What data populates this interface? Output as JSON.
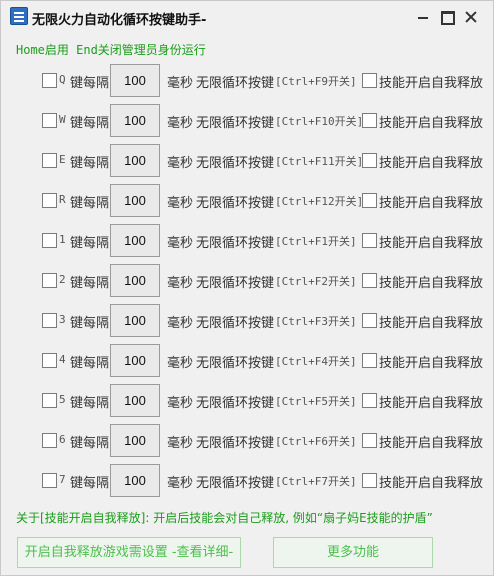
{
  "window": {
    "title": "无限火力自动化循环按键助手-"
  },
  "hotkey_hint": "Home启用 End关闭管理员身份运行",
  "rows": [
    {
      "key": "Q",
      "every": "键每隔",
      "interval": "100",
      "ms": "毫秒",
      "loop": "无限循环按键",
      "shortcut": "[Ctrl+F9开关]",
      "self_cast": "技能开启自我释放"
    },
    {
      "key": "W",
      "every": "键每隔",
      "interval": "100",
      "ms": "毫秒",
      "loop": "无限循环按键",
      "shortcut": "[Ctrl+F10开关]",
      "self_cast": "技能开启自我释放"
    },
    {
      "key": "E",
      "every": "键每隔",
      "interval": "100",
      "ms": "毫秒",
      "loop": "无限循环按键",
      "shortcut": "[Ctrl+F11开关]",
      "self_cast": "技能开启自我释放"
    },
    {
      "key": "R",
      "every": "键每隔",
      "interval": "100",
      "ms": "毫秒",
      "loop": "无限循环按键",
      "shortcut": "[Ctrl+F12开关]",
      "self_cast": "技能开启自我释放"
    },
    {
      "key": "1",
      "every": "键每隔",
      "interval": "100",
      "ms": "毫秒",
      "loop": "无限循环按键",
      "shortcut": "[Ctrl+F1开关]",
      "self_cast": "技能开启自我释放"
    },
    {
      "key": "2",
      "every": "键每隔",
      "interval": "100",
      "ms": "毫秒",
      "loop": "无限循环按键",
      "shortcut": "[Ctrl+F2开关]",
      "self_cast": "技能开启自我释放"
    },
    {
      "key": "3",
      "every": "键每隔",
      "interval": "100",
      "ms": "毫秒",
      "loop": "无限循环按键",
      "shortcut": "[Ctrl+F3开关]",
      "self_cast": "技能开启自我释放"
    },
    {
      "key": "4",
      "every": "键每隔",
      "interval": "100",
      "ms": "毫秒",
      "loop": "无限循环按键",
      "shortcut": "[Ctrl+F4开关]",
      "self_cast": "技能开启自我释放"
    },
    {
      "key": "5",
      "every": "键每隔",
      "interval": "100",
      "ms": "毫秒",
      "loop": "无限循环按键",
      "shortcut": "[Ctrl+F5开关]",
      "self_cast": "技能开启自我释放"
    },
    {
      "key": "6",
      "every": "键每隔",
      "interval": "100",
      "ms": "毫秒",
      "loop": "无限循环按键",
      "shortcut": "[Ctrl+F6开关]",
      "self_cast": "技能开启自我释放"
    },
    {
      "key": "7",
      "every": "键每隔",
      "interval": "100",
      "ms": "毫秒",
      "loop": "无限循环按键",
      "shortcut": "[Ctrl+F7开关]",
      "self_cast": "技能开启自我释放"
    }
  ],
  "note": "关于[技能开启自我释放]: 开启后技能会对自己释放, 例如“扇子妈E技能的护盾”",
  "buttons": {
    "settings": "开启自我释放游戏需设置 -查看详细-",
    "more": "更多功能"
  },
  "colors": {
    "accent_green": "#1a9d1a",
    "button_text_green": "#4cbf4c"
  }
}
